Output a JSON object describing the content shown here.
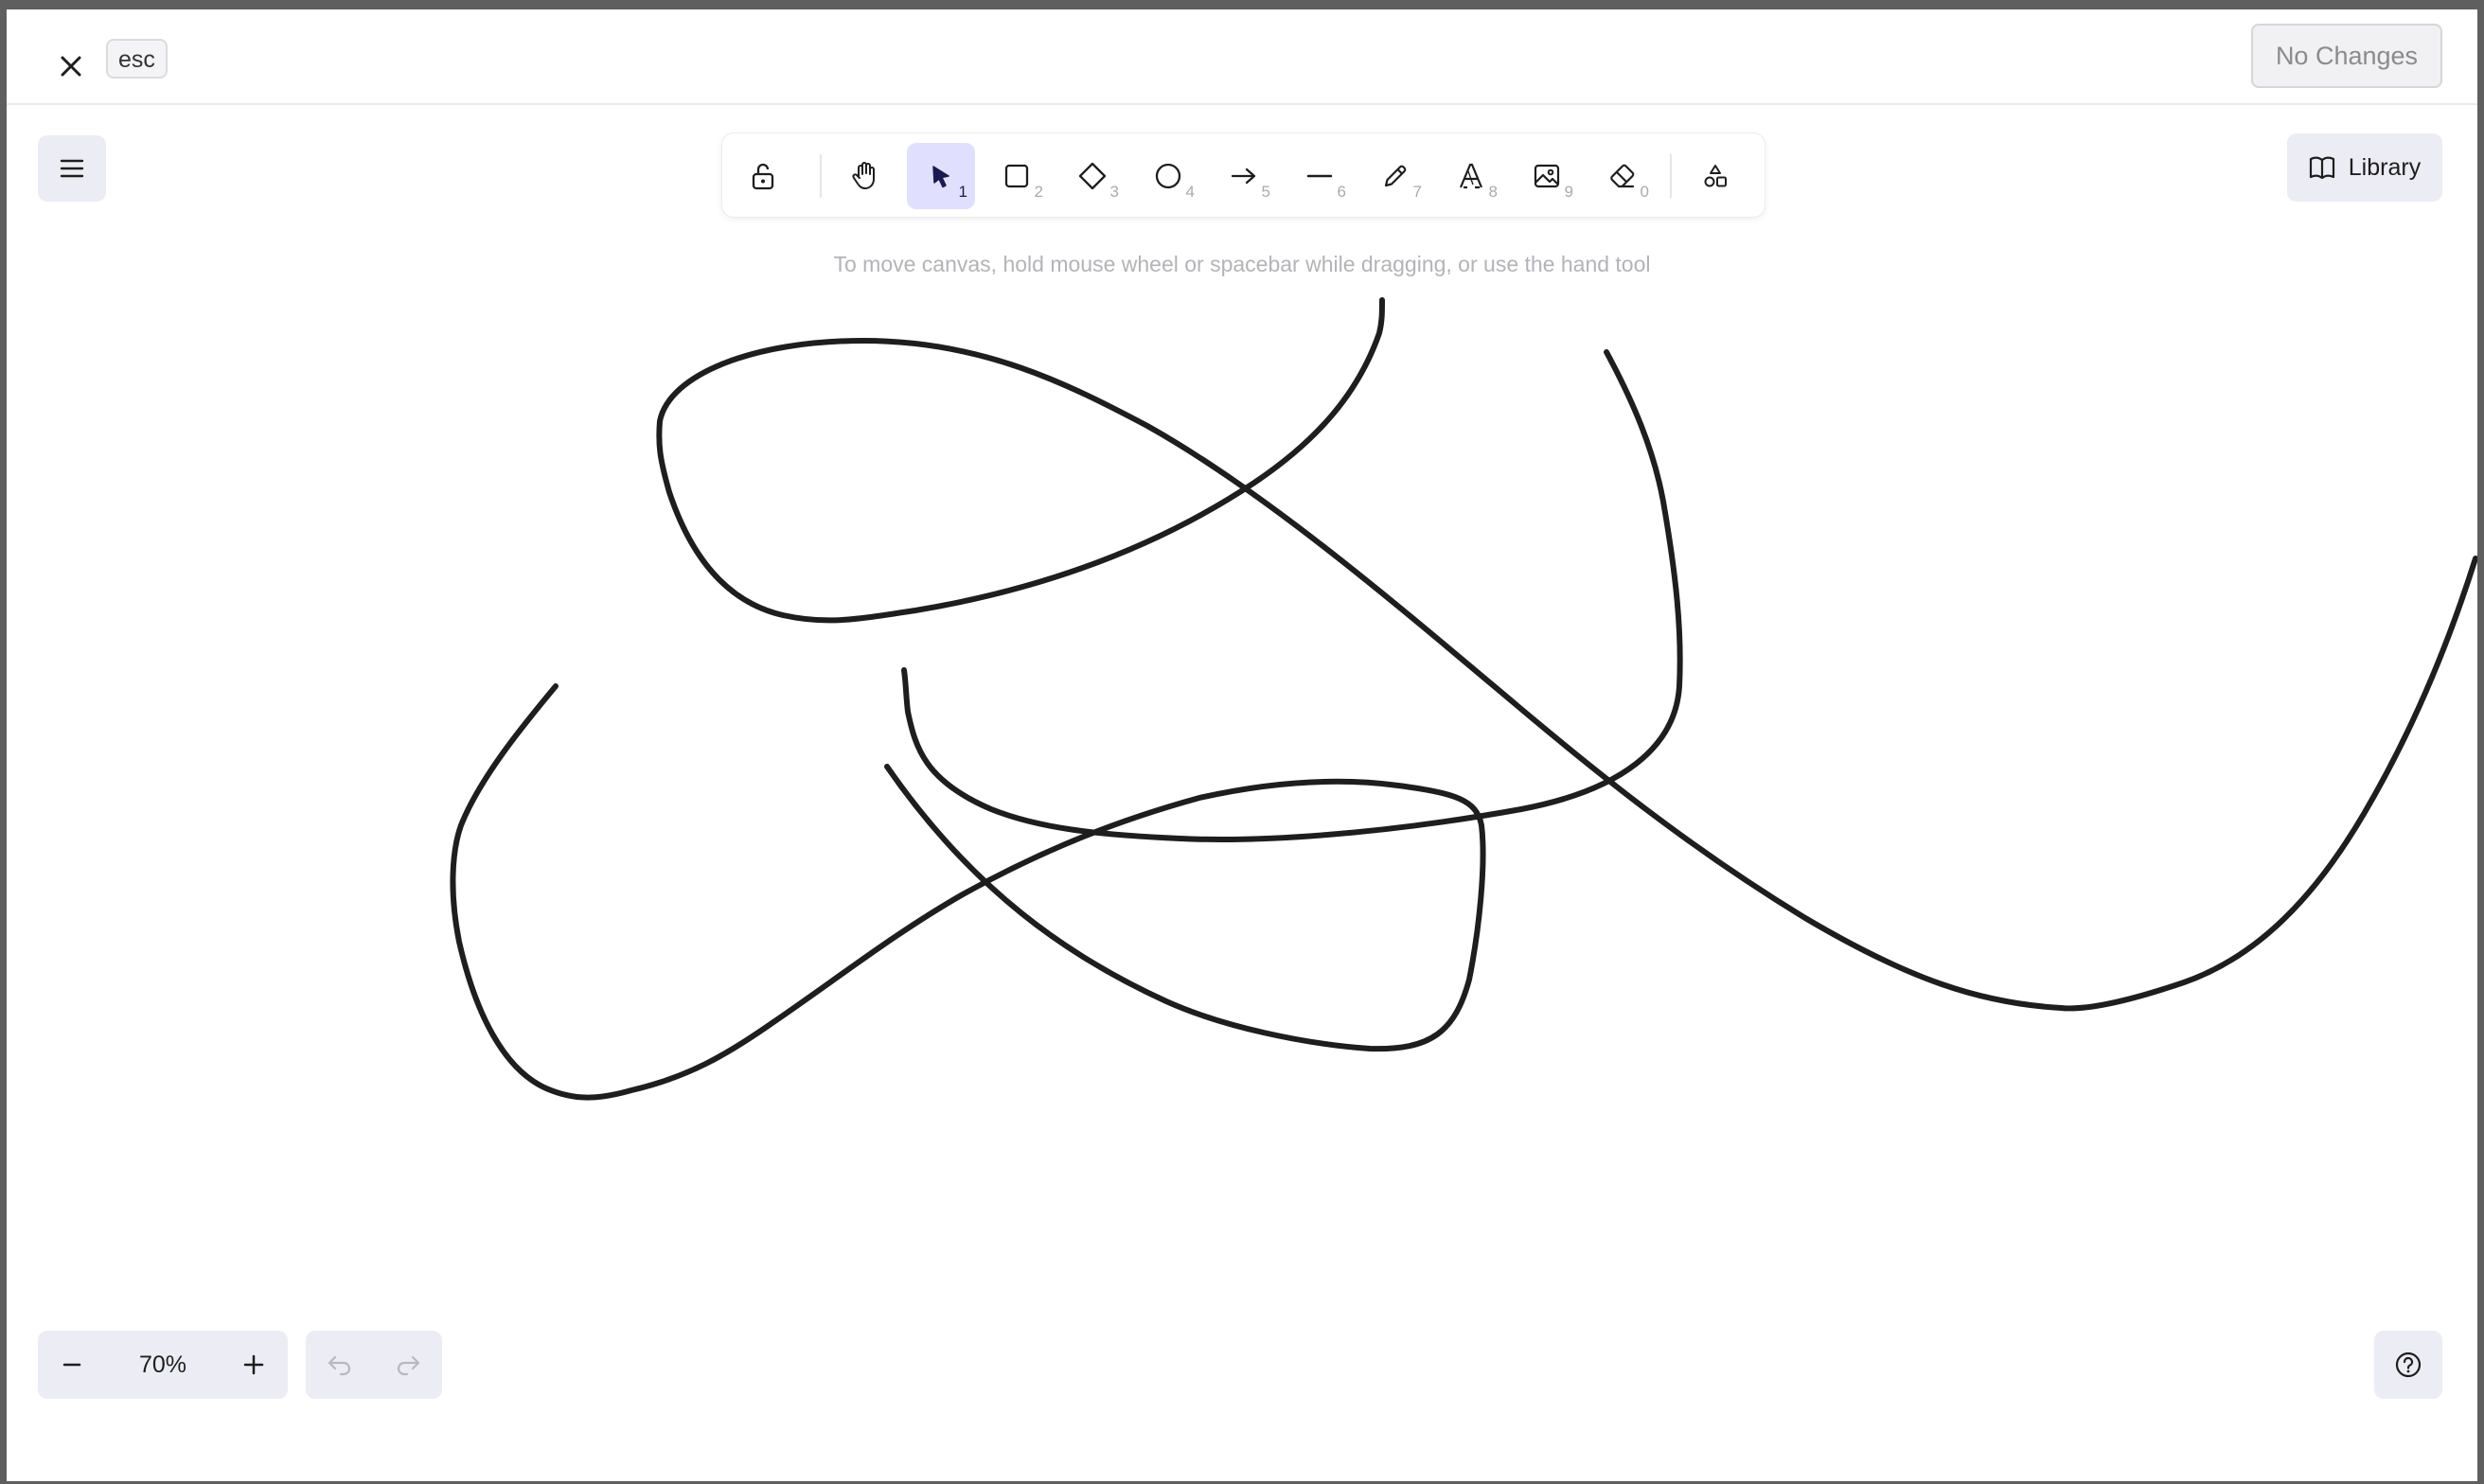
{
  "header": {
    "esc_label": "esc",
    "status_button": "No Changes"
  },
  "toolbar": {
    "tools": [
      {
        "name": "lock",
        "icon": "lock-open-icon",
        "key": ""
      },
      {
        "name": "hand",
        "icon": "hand-icon",
        "key": ""
      },
      {
        "name": "selection",
        "icon": "pointer-icon",
        "key": "1",
        "active": true
      },
      {
        "name": "rectangle",
        "icon": "rectangle-icon",
        "key": "2"
      },
      {
        "name": "diamond",
        "icon": "diamond-icon",
        "key": "3"
      },
      {
        "name": "ellipse",
        "icon": "ellipse-icon",
        "key": "4"
      },
      {
        "name": "arrow",
        "icon": "arrow-icon",
        "key": "5"
      },
      {
        "name": "line",
        "icon": "line-icon",
        "key": "6"
      },
      {
        "name": "draw",
        "icon": "pencil-icon",
        "key": "7"
      },
      {
        "name": "text",
        "icon": "text-icon",
        "key": "8"
      },
      {
        "name": "image",
        "icon": "image-icon",
        "key": "9"
      },
      {
        "name": "eraser",
        "icon": "eraser-icon",
        "key": "0"
      },
      {
        "name": "more-shapes",
        "icon": "shapes-icon",
        "key": ""
      }
    ]
  },
  "library": {
    "label": "Library"
  },
  "canvas": {
    "hint": "To move canvas, hold mouse wheel or spacebar while dragging, or use the hand tool",
    "stroke_color": "#1e1e1e"
  },
  "footer": {
    "zoom_level": "70%"
  },
  "colors": {
    "accent": "#e0dffe",
    "button_bg": "#ececf4"
  }
}
